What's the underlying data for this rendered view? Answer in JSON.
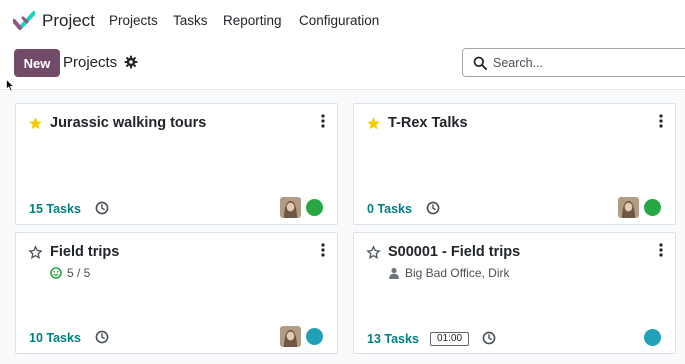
{
  "navbar": {
    "app_name": "Project",
    "menu": [
      "Projects",
      "Tasks",
      "Reporting",
      "Configuration"
    ]
  },
  "control_panel": {
    "new_label": "New",
    "breadcrumb": "Projects",
    "search_placeholder": "Search..."
  },
  "colors": {
    "brand": "#714b67",
    "link": "#017e84",
    "status_green": "#28a745",
    "status_teal": "#21a1b8",
    "favorite_star": "#f3cc00"
  },
  "cards": [
    {
      "title": "Jurassic walking tours",
      "favorite": true,
      "tasks": "15 Tasks",
      "status": "green"
    },
    {
      "title": "T-Rex Talks",
      "favorite": true,
      "tasks": "0 Tasks",
      "status": "green"
    },
    {
      "title": "Field trips",
      "favorite": false,
      "sub": "5 / 5",
      "sub_icon": "smile-icon",
      "tasks": "10 Tasks",
      "status": "teal"
    },
    {
      "title": "S00001 - Field trips",
      "favorite": false,
      "sub": "Big Bad Office, Dirk",
      "sub_icon": "user-icon",
      "tasks": "13 Tasks",
      "time": "01:00",
      "status": "teal"
    }
  ]
}
